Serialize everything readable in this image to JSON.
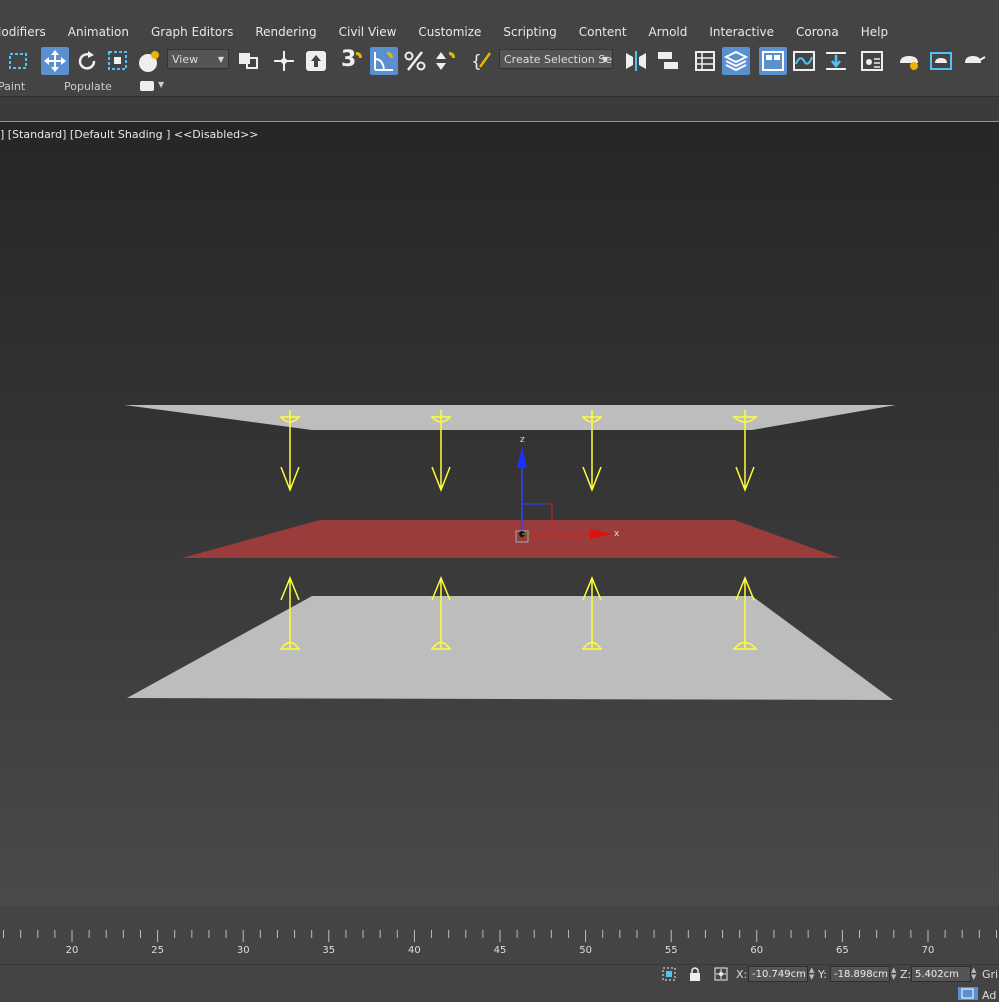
{
  "menu": {
    "items": [
      "Modifiers",
      "Animation",
      "Graph Editors",
      "Rendering",
      "Civil View",
      "Customize",
      "Scripting",
      "Content",
      "Arnold",
      "Interactive",
      "Corona",
      "Help"
    ]
  },
  "toolbar": {
    "ref_coord_value": "View",
    "named_selection_value": "Create Selection Se",
    "snap_label": "3"
  },
  "ribbon": {
    "tabs": [
      "Paint",
      "Populate"
    ]
  },
  "viewport": {
    "label": "] [Standard] [Default Shading ]  <<Disabled>>",
    "axis_x": "x",
    "axis_z": "z"
  },
  "timeline": {
    "ticks": [
      "20",
      "25",
      "30",
      "35",
      "40",
      "45",
      "50",
      "55",
      "60",
      "65",
      "70"
    ]
  },
  "status": {
    "x_label": "X:",
    "x_value": "-10.749cm",
    "y_label": "Y:",
    "y_value": "-18.898cm",
    "z_label": "Z:",
    "z_value": "5.402cm",
    "grid_label": "Gri",
    "add_label": "Ad"
  },
  "colors": {
    "accent": "#5a8fd0",
    "viewport_border": "#b69a2a",
    "force_arrows": "#ffff33",
    "selected_plane": "#9a3c3c",
    "plane": "#bdbdbd"
  }
}
